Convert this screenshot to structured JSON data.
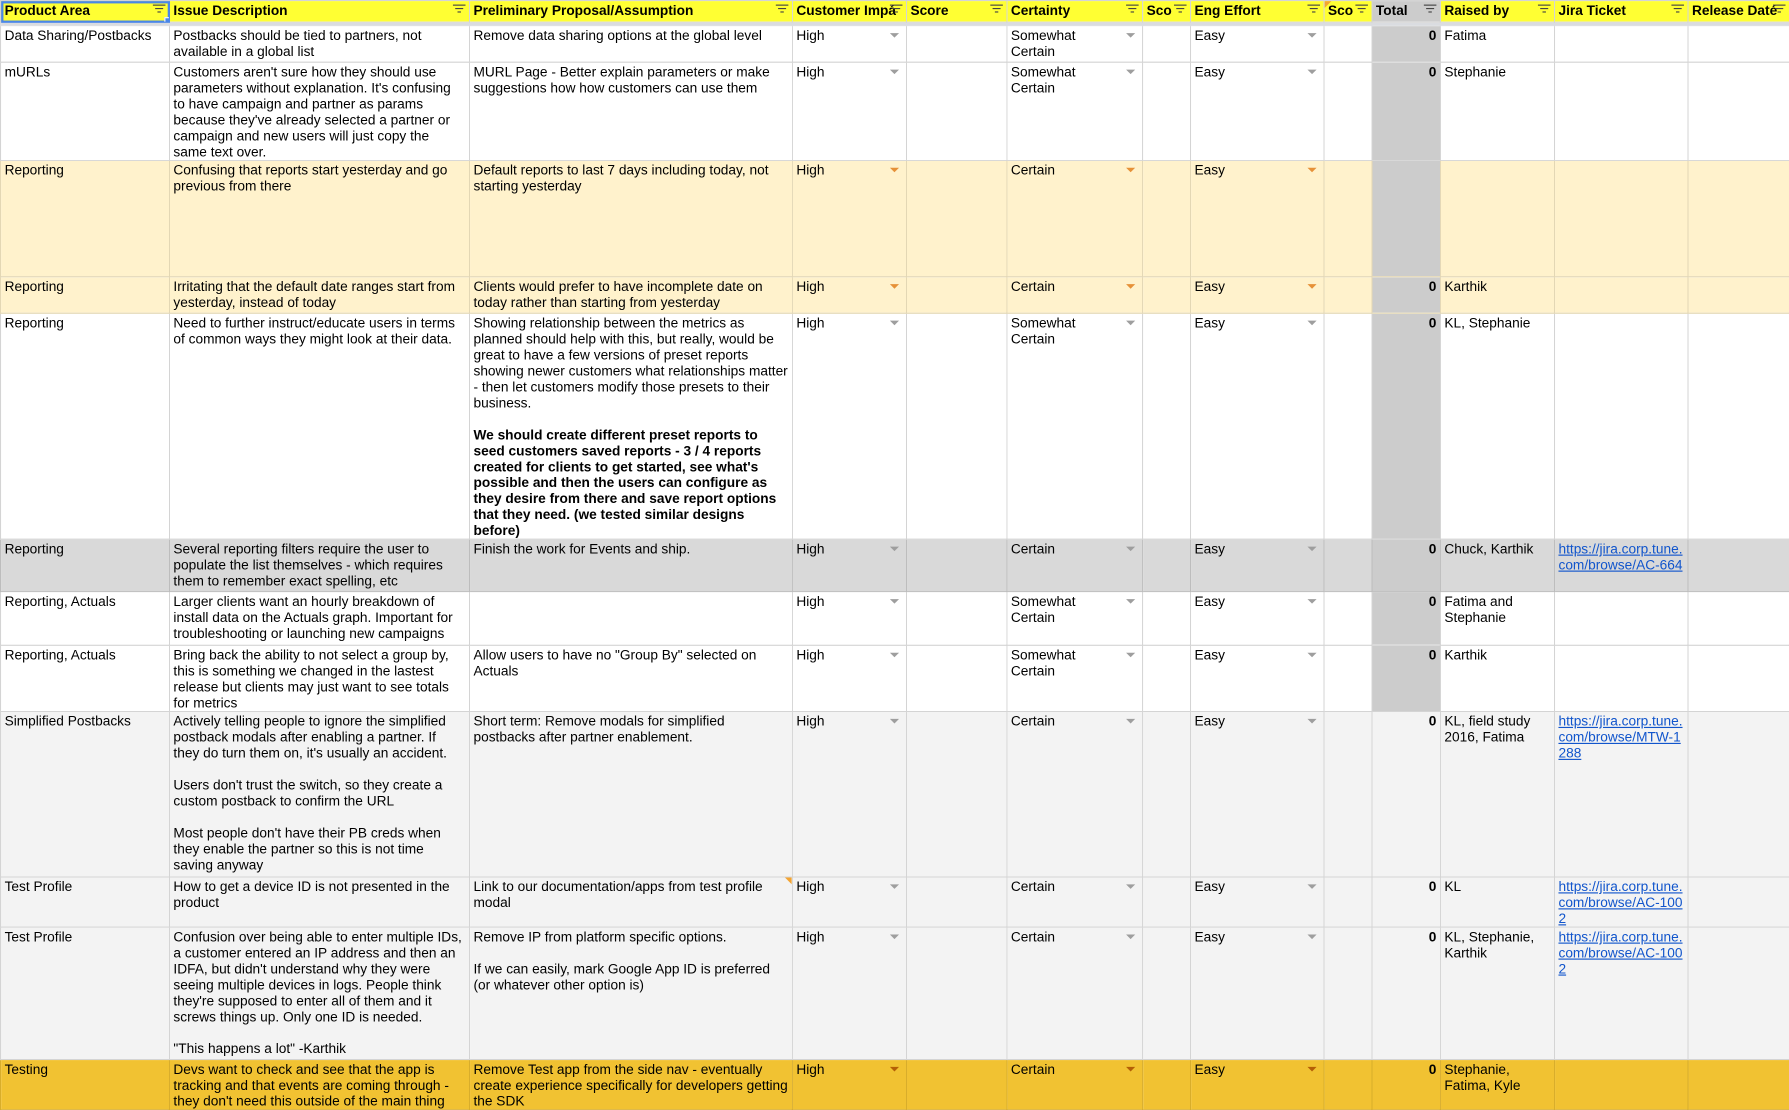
{
  "columns": [
    {
      "label": "Product Area"
    },
    {
      "label": "Issue Description"
    },
    {
      "label": "Preliminary Proposal/Assumption"
    },
    {
      "label": "Customer Impact",
      "display": "Customer Impá"
    },
    {
      "label": "Score"
    },
    {
      "label": "Certainty"
    },
    {
      "label": "Score",
      "display": "Sco"
    },
    {
      "label": "Eng Effort"
    },
    {
      "label": "Score",
      "display": "Sco"
    },
    {
      "label": "Total"
    },
    {
      "label": "Raised by"
    },
    {
      "label": "Jira Ticket"
    },
    {
      "label": "Release Date",
      "display": "Release Daté"
    }
  ],
  "rows": [
    {
      "style": "white",
      "product_area": "Data Sharing/Postbacks",
      "issue": [
        "Postbacks should be tied to partners, not available in a global list"
      ],
      "proposal": [
        {
          "text": "Remove data sharing options at the global level"
        }
      ],
      "customer_impact": "High",
      "score1": "",
      "certainty": "Somewhat Certain",
      "score2": "",
      "eng_effort": "Easy",
      "score3": "",
      "total": "0",
      "raised_by": "Fatima",
      "jira": "",
      "release_date": ""
    },
    {
      "style": "white",
      "product_area": "mURLs",
      "issue": [
        "Customers aren't sure how they should use parameters without explanation. It's confusing to have campaign and partner as params because they've already selected a partner or campaign and new users will just copy the same text over."
      ],
      "proposal": [
        {
          "text": "MURL Page - Better explain parameters or make suggestions how how customers can use them"
        }
      ],
      "customer_impact": "High",
      "score1": "",
      "certainty": "Somewhat Certain",
      "score2": "",
      "eng_effort": "Easy",
      "score3": "",
      "total": "0",
      "raised_by": "Stephanie",
      "jira": "",
      "release_date": ""
    },
    {
      "style": "cream",
      "product_area": "Reporting",
      "issue": [
        "Confusing that reports start yesterday and go previous from there"
      ],
      "proposal": [
        {
          "text": "Default reports to last 7 days including today, not starting yesterday"
        }
      ],
      "customer_impact": "High",
      "score1": "",
      "certainty": "Certain",
      "score2": "",
      "eng_effort": "Easy",
      "score3": "",
      "total": "",
      "raised_by": "",
      "jira": "",
      "release_date": ""
    },
    {
      "style": "cream",
      "product_area": "Reporting",
      "issue": [
        "Irritating that the default date ranges start from yesterday, instead of today"
      ],
      "proposal": [
        {
          "text": "Clients would prefer to have incomplete date on today rather than starting from yesterday"
        }
      ],
      "customer_impact": "High",
      "score1": "",
      "certainty": "Certain",
      "score2": "",
      "eng_effort": "Easy",
      "score3": "",
      "total": "0",
      "raised_by": "Karthik",
      "jira": "",
      "release_date": ""
    },
    {
      "style": "white",
      "product_area": "Reporting",
      "issue": [
        "Need to further instruct/educate users in terms of common ways they might look at their data."
      ],
      "proposal": [
        {
          "text": "Showing relationship between the metrics as planned should help with this, but really, would be great to have a few versions of preset reports showing newer customers what relationships matter - then let customers modify those presets to their business."
        },
        {
          "text": "We should create different preset reports to seed customers saved reports - 3 / 4 reports created for clients to get started, see what's possible and then the users can configure as they desire from there and save report options that they need. (we tested similar designs before)",
          "bold": true
        }
      ],
      "customer_impact": "High",
      "score1": "",
      "certainty": "Somewhat Certain",
      "score2": "",
      "eng_effort": "Easy",
      "score3": "",
      "total": "0",
      "raised_by": "KL, Stephanie",
      "jira": "",
      "release_date": ""
    },
    {
      "style": "gray",
      "product_area": "Reporting",
      "issue": [
        "Several reporting filters require the user to populate the list themselves - which requires them to remember exact spelling, etc"
      ],
      "proposal": [
        {
          "text": "Finish the work for Events and ship."
        }
      ],
      "customer_impact": "High",
      "score1": "",
      "certainty": "Certain",
      "score2": "",
      "eng_effort": "Easy",
      "score3": "",
      "total": "0",
      "raised_by": "Chuck, Karthik",
      "jira": "https://jira.corp.tune.com/browse/AC-664",
      "release_date": ""
    },
    {
      "style": "white",
      "product_area": "Reporting, Actuals",
      "issue": [
        "Larger clients want an hourly breakdown of install data on the Actuals graph. Important for troubleshooting or launching new campaigns"
      ],
      "proposal": [],
      "customer_impact": "High",
      "score1": "",
      "certainty": "Somewhat Certain",
      "score2": "",
      "eng_effort": "Easy",
      "score3": "",
      "total": "0",
      "raised_by": "Fatima and Stephanie",
      "jira": "",
      "release_date": ""
    },
    {
      "style": "white",
      "product_area": "Reporting, Actuals",
      "issue": [
        "Bring back the ability to not select a group by, this is something we changed in the lastest release but clients may just want to see totals for metrics"
      ],
      "proposal": [
        {
          "text": "Allow users to have no \"Group By\" selected on Actuals"
        }
      ],
      "customer_impact": "High",
      "score1": "",
      "certainty": "Somewhat Certain",
      "score2": "",
      "eng_effort": "Easy",
      "score3": "",
      "total": "0",
      "raised_by": "Karthik",
      "jira": "",
      "release_date": ""
    },
    {
      "style": "light",
      "product_area": "Simplified Postbacks",
      "issue": [
        "Actively telling people to ignore the simplified postback modals after enabling a partner. If they do turn them on, it's usually an accident.",
        "Users don't trust the switch, so they create a custom postback to confirm the URL",
        "Most people don't have their PB creds when they enable the partner so this is not time saving anyway"
      ],
      "proposal": [
        {
          "text": "Short term: Remove modals for simplified postbacks after partner enablement."
        }
      ],
      "customer_impact": "High",
      "score1": "",
      "certainty": "Certain",
      "score2": "",
      "eng_effort": "Easy",
      "score3": "",
      "total": "0",
      "raised_by": "KL, field study 2016, Fatima",
      "jira": "https://jira.corp.tune.com/browse/MTW-1288",
      "release_date": ""
    },
    {
      "style": "light",
      "product_area": "Test Profile",
      "issue": [
        "How to get a device ID is not presented in the product"
      ],
      "proposal": [
        {
          "text": "Link to our documentation/apps from test profile modal"
        }
      ],
      "has_note": true,
      "customer_impact": "High",
      "score1": "",
      "certainty": "Certain",
      "score2": "",
      "eng_effort": "Easy",
      "score3": "",
      "total": "0",
      "raised_by": "KL",
      "jira": "https://jira.corp.tune.com/browse/AC-1002",
      "release_date": ""
    },
    {
      "style": "light",
      "product_area": "Test Profile",
      "issue": [
        "Confusion over being able to enter multiple IDs, a customer entered an IP address and then an IDFA, but didn't understand why they were seeing multiple devices in logs. People think they're supposed to enter all of them and it screws things up. Only one ID is needed.",
        "\"This happens a lot\" -Karthik"
      ],
      "proposal": [
        {
          "text": "Remove IP from platform specific options."
        },
        {
          "text": "If we can easily, mark Google App ID is preferred (or whatever other option is)"
        }
      ],
      "customer_impact": "High",
      "score1": "",
      "certainty": "Certain",
      "score2": "",
      "eng_effort": "Easy",
      "score3": "",
      "total": "0",
      "raised_by": "KL, Stephanie, Karthik",
      "jira": "https://jira.corp.tune.com/browse/AC-1002",
      "release_date": ""
    },
    {
      "style": "orange",
      "product_area": "Testing",
      "issue": [
        "Devs want to check and see that the app is tracking and that events are coming through - they don't need this outside of the main thing"
      ],
      "proposal": [
        {
          "text": "Remove Test app from the side nav - eventually create experience specifically for developers getting the SDK"
        }
      ],
      "customer_impact": "High",
      "score1": "",
      "certainty": "Certain",
      "score2": "",
      "eng_effort": "Easy",
      "score3": "",
      "total": "0",
      "raised_by": "Stephanie, Fatima, Kyle",
      "jira": "",
      "release_date": ""
    }
  ]
}
